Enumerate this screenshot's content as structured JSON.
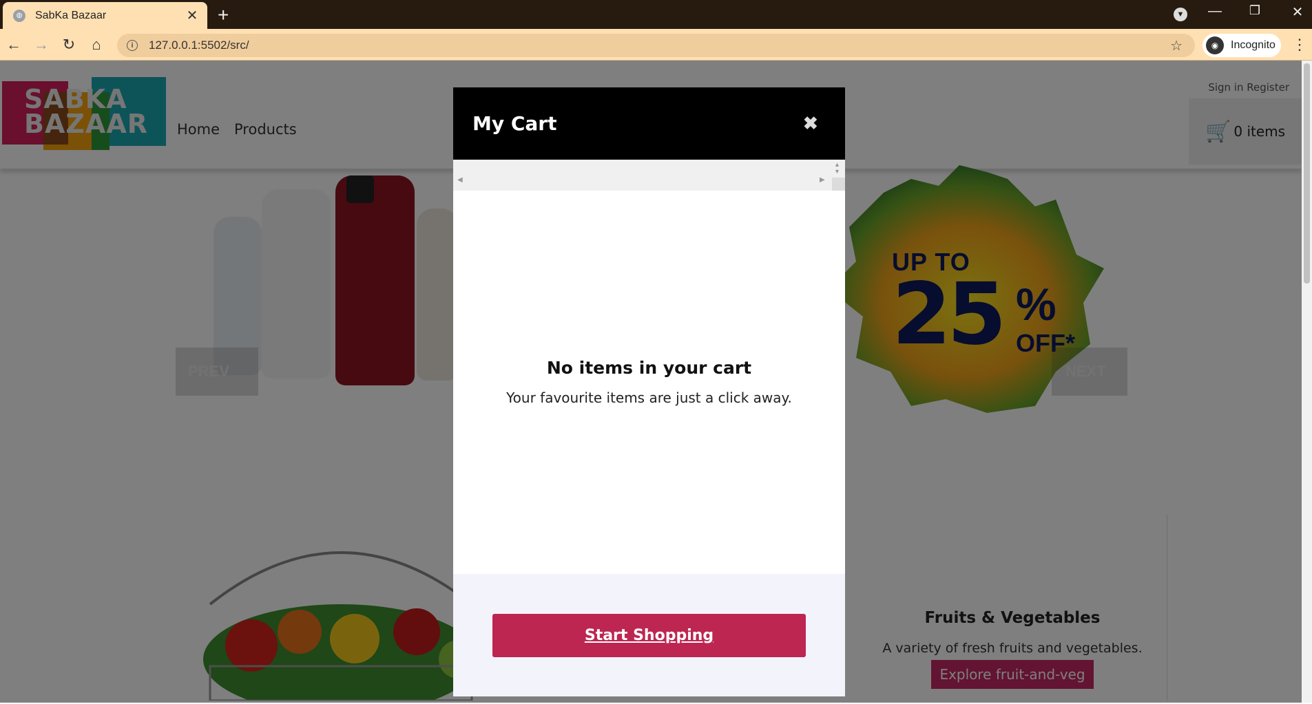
{
  "browser": {
    "tab_title": "SabKa Bazaar",
    "tab_close": "✕",
    "new_tab": "+",
    "url": "127.0.0.1:5502/src/",
    "profile_label": "Incognito",
    "nav": {
      "back": "←",
      "forward": "→",
      "reload": "↻",
      "home": "⌂"
    },
    "window": {
      "minimize": "—",
      "restore": "❐",
      "close": "✕"
    }
  },
  "header": {
    "logo_text": "SABKA BAZAAR",
    "nav_items": [
      "Home",
      "Products"
    ],
    "sign_links": "Sign in Register",
    "cart_label": "0 items"
  },
  "carousel": {
    "prev_label": "PREV",
    "next_label": "NEXT",
    "promo": {
      "line1": "UP TO",
      "big": "25",
      "symbol": "%",
      "off": "OFF*"
    }
  },
  "category": {
    "title": "Fruits & Vegetables",
    "description": "A variety of fresh fruits and vegetables.",
    "button": "Explore fruit-and-veg"
  },
  "cart_modal": {
    "title": "My Cart",
    "close": "✖",
    "empty_heading": "No items in your cart",
    "empty_sub": "Your favourite items are just a click away.",
    "cta": "Start Shopping"
  },
  "colors": {
    "accent": "#bd2651",
    "chrome": "#271b10",
    "toolbar": "#ffe0b3"
  }
}
